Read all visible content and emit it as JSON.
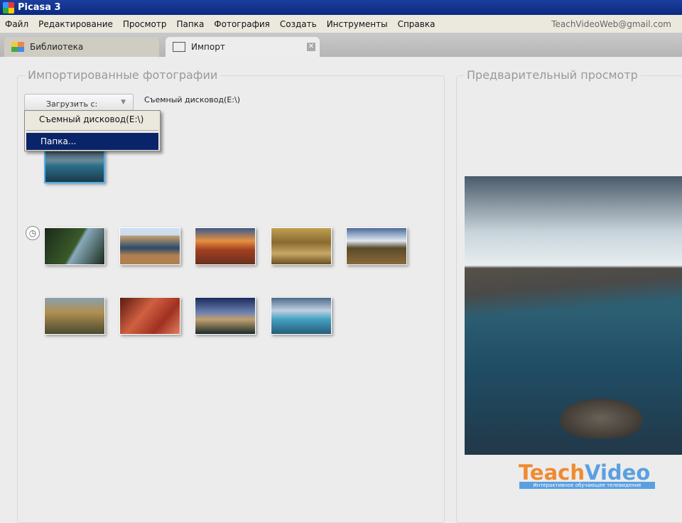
{
  "window": {
    "title": "Picasa 3"
  },
  "menu": [
    "Файл",
    "Редактирование",
    "Просмотр",
    "Папка",
    "Фотография",
    "Создать",
    "Инструменты",
    "Справка"
  ],
  "account": "TeachVideoWeb@gmail.com",
  "tabs": [
    {
      "label": "Библиотека"
    },
    {
      "label": "Импорт"
    }
  ],
  "import": {
    "legend": "Импортированные фотографии",
    "load_from": "Загрузить с:",
    "source": "Съемный дисковод(E:\\)",
    "dropdown": [
      {
        "label": "Съемный дисковод(E:\\)"
      },
      {
        "label": "Папка..."
      }
    ]
  },
  "preview": {
    "legend": "Предварительный просмотр"
  },
  "watermark": {
    "brand_a": "Teach",
    "brand_b": "Video",
    "tagline": "Интерактивное обучающее телевидение"
  },
  "colors": {
    "titlebar": "#0a2a80",
    "menu_selected": "#0a246a",
    "accent": "#5aa0e0"
  }
}
